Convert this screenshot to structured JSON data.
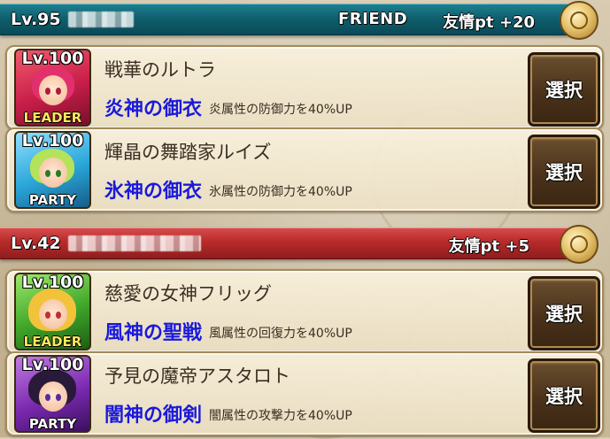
{
  "groups": [
    {
      "level": "Lv.95",
      "tag": "FRIEND",
      "friend_pt": "友情pt +20",
      "header_color": "#0f5f6e",
      "members": [
        {
          "avatar_level": "Lv.100",
          "role": "LEADER",
          "name": "戦華のルトラ",
          "skill": "炎神の御衣",
          "effect": "炎属性の防御力を40%UP",
          "button": "選択"
        },
        {
          "avatar_level": "Lv.100",
          "role": "PARTY",
          "name": "輝晶の舞踏家ルイズ",
          "skill": "氷神の御衣",
          "effect": "氷属性の防御力を40%UP",
          "button": "選択"
        }
      ]
    },
    {
      "level": "Lv.42",
      "tag": "",
      "friend_pt": "友情pt +5",
      "header_color": "#b82a2a",
      "members": [
        {
          "avatar_level": "Lv.100",
          "role": "LEADER",
          "name": "慈愛の女神フリッグ",
          "skill": "風神の聖戦",
          "effect": "風属性の回復力を40%UP",
          "button": "選択"
        },
        {
          "avatar_level": "Lv.100",
          "role": "PARTY",
          "name": "予見の魔帝アスタロト",
          "skill": "闇神の御剣",
          "effect": "闇属性の攻撃力を40%UP",
          "button": "選択"
        }
      ]
    }
  ],
  "skill_color": "#1a1adb"
}
